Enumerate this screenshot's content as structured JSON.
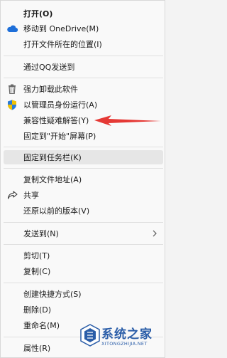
{
  "menu": {
    "items": [
      {
        "id": "open",
        "label": "打开(O)",
        "bold": true
      },
      {
        "id": "move-onedrive",
        "label": "移动到 OneDrive(M)",
        "icon": "cloud-icon"
      },
      {
        "id": "open-location",
        "label": "打开文件所在的位置(I)"
      },
      {
        "id": "send-qq",
        "label": "通过QQ发送到"
      },
      {
        "id": "force-uninstall",
        "label": "强力卸载此软件",
        "icon": "trash-icon"
      },
      {
        "id": "run-admin",
        "label": "以管理员身份运行(A)",
        "icon": "uac-shield-icon"
      },
      {
        "id": "compat-troubleshoot",
        "label": "兼容性疑难解答(Y)"
      },
      {
        "id": "pin-start",
        "label": "固定到\"开始\"屏幕(P)"
      },
      {
        "id": "pin-taskbar",
        "label": "固定到任务栏(K)"
      },
      {
        "id": "copy-path",
        "label": "复制文件地址(A)"
      },
      {
        "id": "share",
        "label": "共享",
        "icon": "share-icon"
      },
      {
        "id": "restore-prev",
        "label": "还原以前的版本(V)"
      },
      {
        "id": "send-to",
        "label": "发送到(N)",
        "submenu": true
      },
      {
        "id": "cut",
        "label": "剪切(T)"
      },
      {
        "id": "copy",
        "label": "复制(C)"
      },
      {
        "id": "create-shortcut",
        "label": "创建快捷方式(S)"
      },
      {
        "id": "delete",
        "label": "删除(D)"
      },
      {
        "id": "rename",
        "label": "重命名(M)"
      },
      {
        "id": "properties",
        "label": "属性(R)"
      }
    ]
  },
  "watermark": {
    "text": "系统之家",
    "url": "XITONGZHIJIA.NET"
  },
  "colors": {
    "annotation_arrow": "#e53935",
    "watermark": "#2a5da8",
    "highlight": "#e6e6e6"
  }
}
